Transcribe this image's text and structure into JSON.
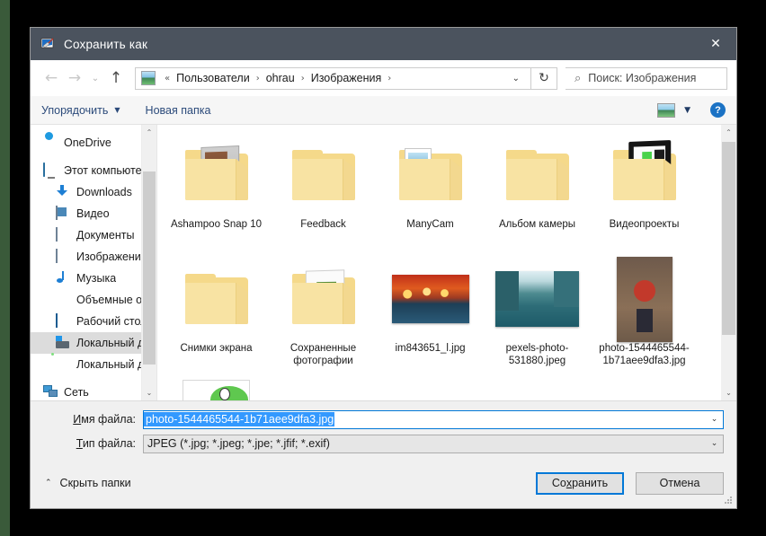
{
  "window": {
    "title": "Сохранить как",
    "title_icon": "paint-app-icon",
    "close_label": "✕"
  },
  "nav": {
    "back_icon": "arrow-left-icon",
    "forward_icon": "arrow-right-icon",
    "history_icon": "chevron-down-icon",
    "up_icon": "arrow-up-icon",
    "address_icon": "pictures-folder-icon",
    "breadcrumb_lead": "«",
    "breadcrumbs": [
      "Пользователи",
      "ohrau",
      "Изображения"
    ],
    "separator": "›",
    "dropdown_icon": "chevron-down-icon",
    "refresh_icon": "refresh-icon",
    "refresh_glyph": "↻"
  },
  "search": {
    "icon": "search-icon",
    "placeholder": "Поиск: Изображения"
  },
  "toolbar": {
    "organize_label": "Упорядочить",
    "organize_caret": "▼",
    "new_folder_label": "Новая папка",
    "view_icon": "view-layout-icon",
    "view_caret": "▼",
    "help_icon": "help-icon",
    "help_glyph": "?"
  },
  "sidebar": {
    "items": [
      {
        "label": "OneDrive",
        "icon": "onedrive-cloud-icon",
        "indent": false,
        "selected": false,
        "spaced": false
      },
      {
        "label": "Этот компьютер",
        "icon": "this-pc-monitor-icon",
        "indent": false,
        "selected": false,
        "spaced": true
      },
      {
        "label": "Downloads",
        "icon": "downloads-arrow-icon",
        "indent": true,
        "selected": false,
        "spaced": false
      },
      {
        "label": "Видео",
        "icon": "videos-film-icon",
        "indent": true,
        "selected": false,
        "spaced": false
      },
      {
        "label": "Документы",
        "icon": "documents-icon",
        "indent": true,
        "selected": false,
        "spaced": false
      },
      {
        "label": "Изображения",
        "icon": "pictures-icon",
        "indent": true,
        "selected": false,
        "spaced": false
      },
      {
        "label": "Музыка",
        "icon": "music-note-icon",
        "indent": true,
        "selected": false,
        "spaced": false
      },
      {
        "label": "Объемные объекты",
        "icon": "3d-objects-icon",
        "indent": true,
        "selected": false,
        "spaced": false
      },
      {
        "label": "Рабочий стол",
        "icon": "desktop-icon",
        "indent": true,
        "selected": false,
        "spaced": false
      },
      {
        "label": "Локальный диск",
        "icon": "local-disk-windows-icon",
        "indent": true,
        "selected": true,
        "spaced": false
      },
      {
        "label": "Локальный диск",
        "icon": "local-disk-icon",
        "indent": true,
        "selected": false,
        "spaced": false
      },
      {
        "label": "Сеть",
        "icon": "network-icon",
        "indent": false,
        "selected": false,
        "spaced": true
      }
    ],
    "scroll_up_icon": "chevron-up-icon",
    "scroll_down_icon": "chevron-down-icon"
  },
  "files": {
    "items": [
      {
        "name": "Ashampoo Snap 10",
        "kind": "folder",
        "overlay": "snap-preview"
      },
      {
        "name": "Feedback",
        "kind": "folder",
        "overlay": "none"
      },
      {
        "name": "ManyCam",
        "kind": "folder",
        "overlay": "doc-preview"
      },
      {
        "name": "Альбом камеры",
        "kind": "folder",
        "overlay": "none"
      },
      {
        "name": "Видеопроекты",
        "kind": "folder",
        "overlay": "video-preview"
      },
      {
        "name": "Снимки экрана",
        "kind": "folder",
        "overlay": "none"
      },
      {
        "name": "Сохраненные фотографии",
        "kind": "folder",
        "overlay": "saved-preview"
      },
      {
        "name": "im843651_l.jpg",
        "kind": "image",
        "overlay": "art-thumb"
      },
      {
        "name": "pexels-photo-531880.jpeg",
        "kind": "image",
        "overlay": "city-thumb"
      },
      {
        "name": "photo-1544465544-1b71aee9dfa3.jpg",
        "kind": "image",
        "overlay": "girl-thumb"
      }
    ],
    "partial_item": {
      "name": "",
      "overlay": "yoshi-thumb"
    },
    "scroll_up_icon": "chevron-up-icon",
    "scroll_down_icon": "chevron-down-icon"
  },
  "form": {
    "filename_label_pre": "И",
    "filename_label_post": "мя файла:",
    "filename_value": "photo-1544465544-1b71aee9dfa3.jpg",
    "filetype_label_pre": "Т",
    "filetype_label_post": "ип файла:",
    "filetype_value": "JPEG (*.jpg; *.jpeg; *.jpe; *.jfif; *.exif)",
    "caret_icon": "chevron-down-icon",
    "caret_glyph": "⌄"
  },
  "footer": {
    "hide_folders_label": "Скрыть папки",
    "hide_folders_caret": "⌃",
    "save_label_pre": "Со",
    "save_label_mid": "х",
    "save_label_post": "ранить",
    "cancel_label": "Отмена"
  },
  "colors": {
    "titlebar": "#4b535e",
    "accent": "#0078d7",
    "selection": "#3399ff",
    "dialog_bg": "#f0f0f0"
  }
}
